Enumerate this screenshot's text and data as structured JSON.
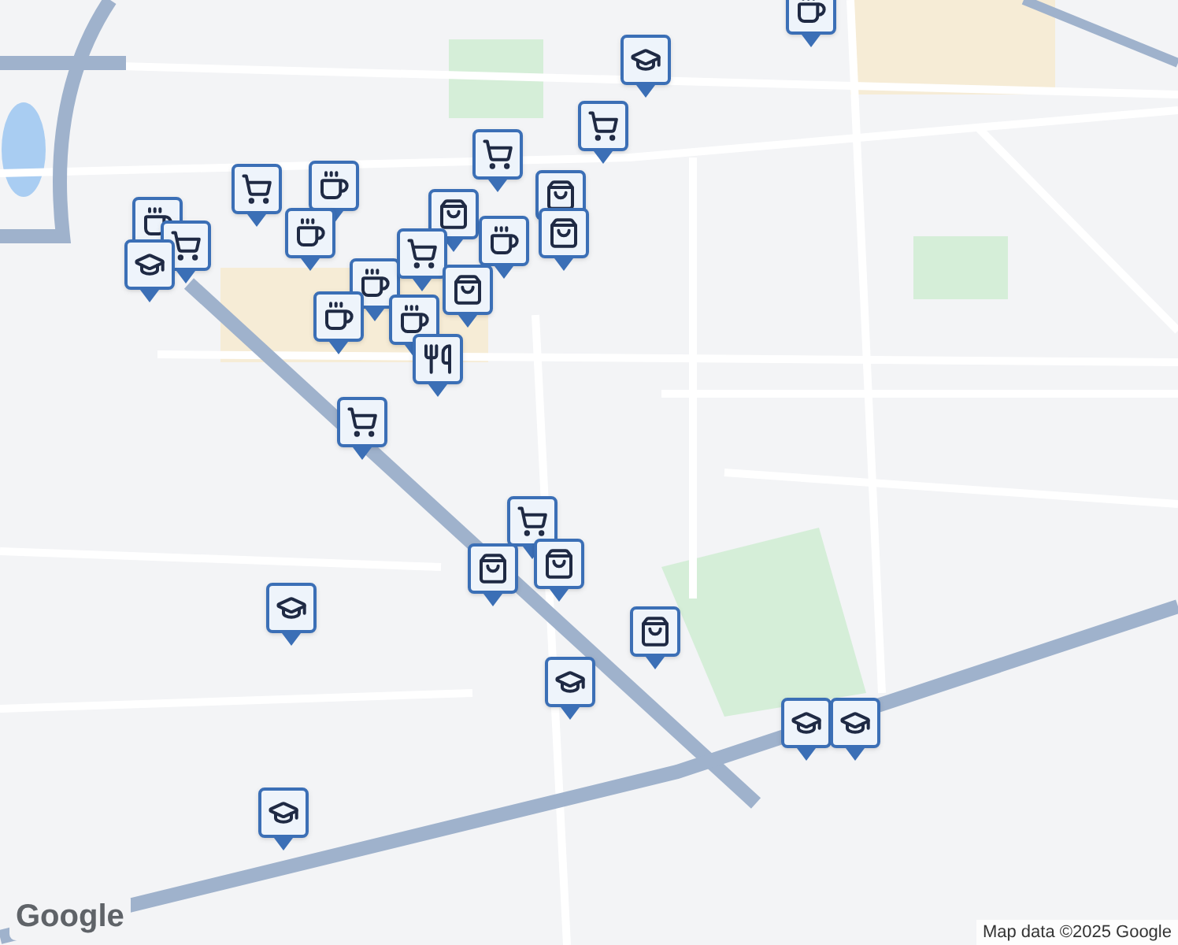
{
  "map": {
    "markers": [
      {
        "kind": "coffee"
      },
      {
        "kind": "school"
      },
      {
        "kind": "cart"
      },
      {
        "kind": "cart"
      },
      {
        "kind": "coffee"
      },
      {
        "kind": "cart"
      },
      {
        "kind": "bag"
      },
      {
        "kind": "coffee"
      },
      {
        "kind": "cart"
      },
      {
        "kind": "school"
      },
      {
        "kind": "coffee"
      },
      {
        "kind": "bag"
      },
      {
        "kind": "coffee"
      },
      {
        "kind": "bag"
      },
      {
        "kind": "coffee"
      },
      {
        "kind": "cart"
      },
      {
        "kind": "bag"
      },
      {
        "kind": "coffee"
      },
      {
        "kind": "coffee"
      },
      {
        "kind": "restaurant"
      },
      {
        "kind": "cart"
      },
      {
        "kind": "cart"
      },
      {
        "kind": "bag"
      },
      {
        "kind": "bag"
      },
      {
        "kind": "school"
      },
      {
        "kind": "bag"
      },
      {
        "kind": "school"
      },
      {
        "kind": "school"
      },
      {
        "kind": "school"
      },
      {
        "kind": "school"
      }
    ]
  },
  "google_logo": "Google",
  "attribution": "Map data ©2025 Google"
}
